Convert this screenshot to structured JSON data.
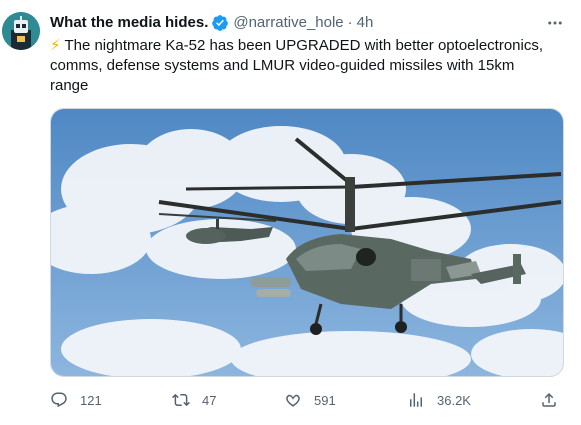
{
  "tweet": {
    "display_name": "What the media hides.",
    "handle": "@narrative_hole",
    "separator": "·",
    "time": "4h",
    "text_emoji": "⚡",
    "text": "The nightmare Ka-52 has been UPGRADED with better optoelectronics, comms, defense systems and LMUR video-guided missiles with 15km range",
    "avatar_icon": "avatar-robot-icon",
    "verified_color": "#1d9bf0"
  },
  "actions": {
    "reply_count": "121",
    "retweet_count": "47",
    "like_count": "591",
    "views_count": "36.2K"
  },
  "colors": {
    "sky": "#6e9fd1",
    "text_secondary": "#536471"
  }
}
